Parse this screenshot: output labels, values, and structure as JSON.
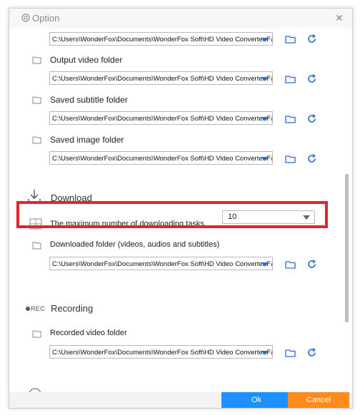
{
  "window": {
    "title": "Option",
    "close_glyph": "✕"
  },
  "folders": [
    {
      "label": "",
      "path": "C:\\Users\\WonderFox\\Documents\\WonderFox Soft\\HD Video Converter Facto"
    },
    {
      "label": "Output video folder",
      "path": "C:\\Users\\WonderFox\\Documents\\WonderFox Soft\\HD Video Converter Facto"
    },
    {
      "label": "Saved subtitle folder",
      "path": "C:\\Users\\WonderFox\\Documents\\WonderFox Soft\\HD Video Converter Facto"
    },
    {
      "label": "Saved image folder",
      "path": "C:\\Users\\WonderFox\\Documents\\WonderFox Soft\\HD Video Converter Facto"
    }
  ],
  "download": {
    "heading": "Download",
    "max_tasks_label": "The maximum number of downloading tasks.",
    "max_tasks_value": "10",
    "folder_label": "Downloaded folder (videos, audios and subtitles)",
    "folder_path": "C:\\Users\\WonderFox\\Documents\\WonderFox Soft\\HD Video Converter Facto"
  },
  "recording": {
    "heading": "Recording",
    "rec_badge": "REC",
    "folder_label": "Recorded video folder",
    "folder_path": "C:\\Users\\WonderFox\\Documents\\WonderFox Soft\\HD Video Converter Facto"
  },
  "buttons": {
    "ok": "Ok",
    "cancel": "Cancel"
  },
  "colors": {
    "accent": "#1e90ff",
    "cancel": "#ff8a1e",
    "highlight": "#e0262b",
    "icon_blue": "#2a6bd6"
  }
}
